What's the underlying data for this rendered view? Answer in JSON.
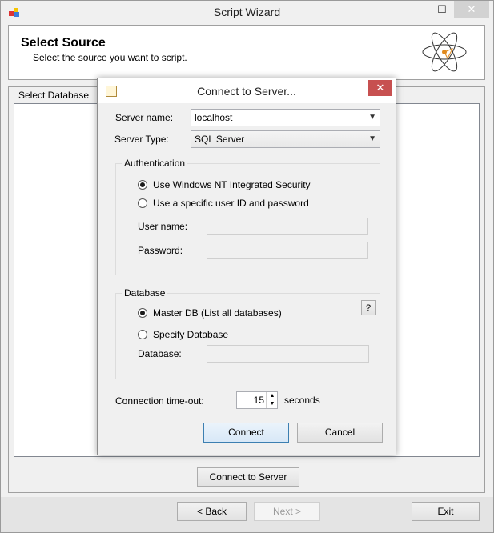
{
  "window": {
    "title": "Script Wizard",
    "min_glyph": "—",
    "max_glyph": "☐",
    "close_glyph": "✕"
  },
  "header": {
    "title": "Select Source",
    "subtitle": "Select the source you want to script."
  },
  "select_database": {
    "label": "Select Database",
    "connect_button": "Connect to Server"
  },
  "footer": {
    "back": "< Back",
    "next": "Next >",
    "exit": "Exit"
  },
  "dialog": {
    "title": "Connect to Server...",
    "close_glyph": "✕",
    "server_name_label": "Server name:",
    "server_name_value": "localhost",
    "server_type_label": "Server Type:",
    "server_type_value": "SQL Server",
    "auth": {
      "label": "Authentication",
      "option_windows": "Use Windows NT Integrated Security",
      "option_specific": "Use a specific user ID and password",
      "selected": "windows",
      "username_label": "User name:",
      "password_label": "Password:"
    },
    "database": {
      "label": "Database",
      "option_master": "Master DB (List all databases)",
      "option_specify": "Specify Database",
      "selected": "master",
      "database_label": "Database:",
      "help": "?"
    },
    "timeout_label": "Connection time-out:",
    "timeout_value": "15",
    "timeout_unit": "seconds",
    "connect": "Connect",
    "cancel": "Cancel"
  }
}
